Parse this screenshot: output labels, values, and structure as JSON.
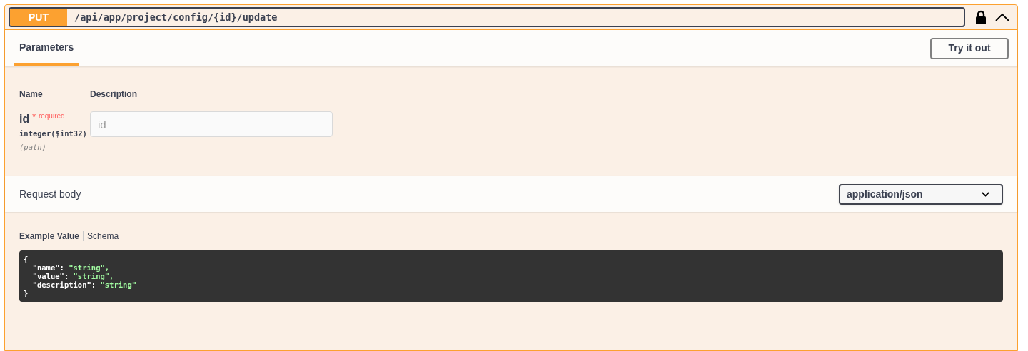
{
  "operation": {
    "method": "PUT",
    "path": "/api/app/project/config/{id}/update",
    "locked": true,
    "expanded": true
  },
  "tabs": [
    {
      "label": "Parameters",
      "selected": true
    }
  ],
  "try_button": "Try it out",
  "parameters": {
    "columns": [
      "Name",
      "Description"
    ],
    "rows": [
      {
        "name": "id",
        "star": "*",
        "required": "required",
        "type": "integer($int32)",
        "location": "(path)",
        "placeholder": "id"
      }
    ]
  },
  "request_body": {
    "title": "Request body",
    "content_type": "application/json"
  },
  "example_tabs": [
    {
      "label": "Example Value",
      "selected": true
    },
    {
      "label": "Schema",
      "selected": false
    }
  ],
  "example_lines": [
    {
      "kind": "brace",
      "text": "{"
    },
    {
      "kind": "pair",
      "key": "  \"name\": ",
      "value": "\"string\","
    },
    {
      "kind": "pair",
      "key": "  \"value\": ",
      "value": "\"string\","
    },
    {
      "kind": "pair",
      "key": "  \"description\": ",
      "value": "\"string\""
    },
    {
      "kind": "brace",
      "text": "}"
    }
  ]
}
